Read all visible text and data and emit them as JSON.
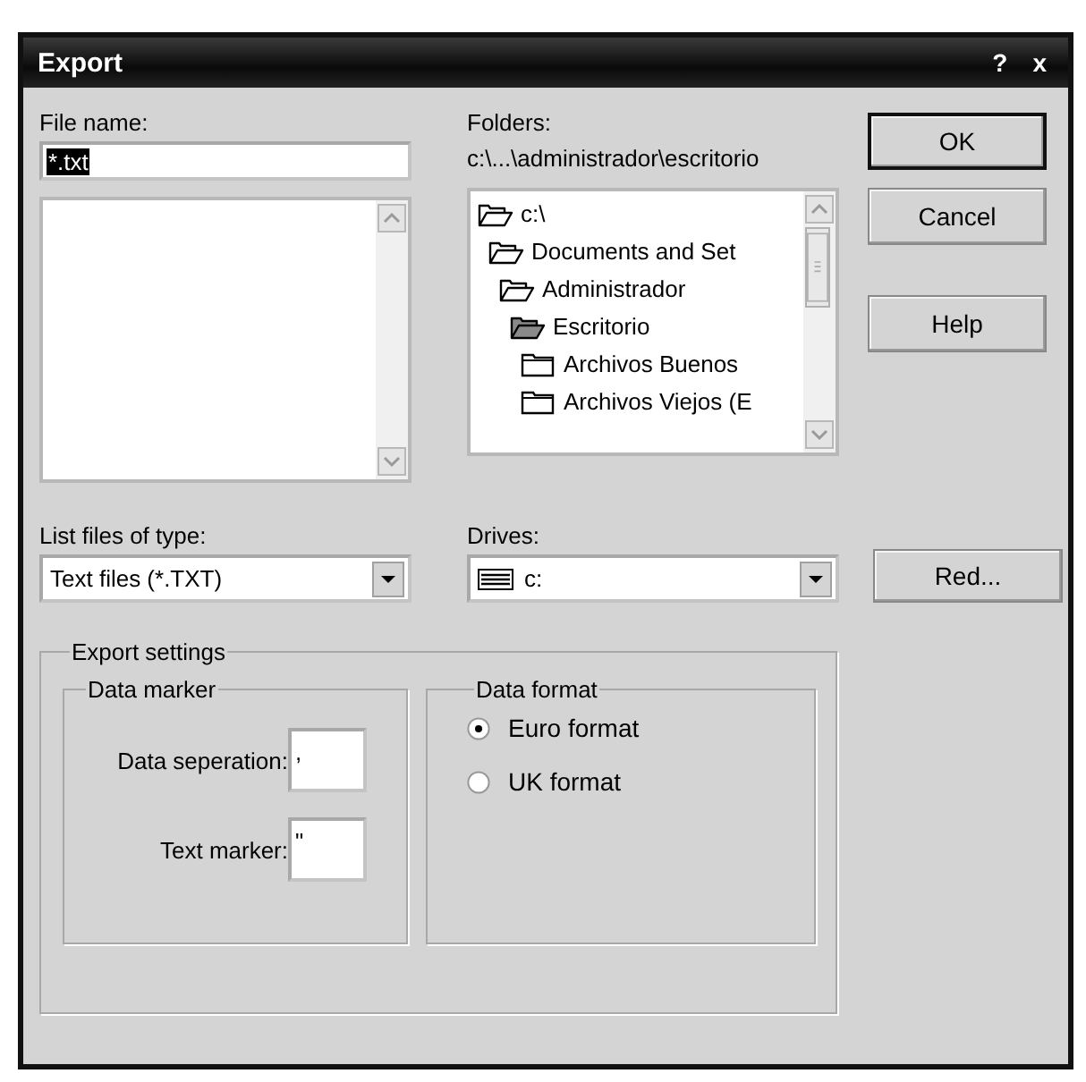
{
  "window": {
    "title": "Export",
    "title_buttons": [
      "?",
      "x"
    ]
  },
  "file_name": {
    "label": "File name:",
    "value": "*.txt",
    "selected": true
  },
  "folders": {
    "label": "Folders:",
    "path": "c:\\...\\administrador\\escritorio",
    "tree": [
      {
        "label": "c:\\",
        "kind": "open",
        "children": [
          {
            "label": "Documents and Set",
            "kind": "open",
            "children": [
              {
                "label": "Administrador",
                "kind": "open",
                "children": [
                  {
                    "label": "Escritorio",
                    "kind": "current",
                    "children": [
                      {
                        "label": "Archivos Buenos",
                        "kind": "closed"
                      },
                      {
                        "label": "Archivos Viejos (E",
                        "kind": "closed"
                      }
                    ]
                  }
                ]
              }
            ]
          }
        ]
      }
    ]
  },
  "file_type": {
    "label": "List files of type:",
    "value": "Text files (*.TXT)"
  },
  "drives": {
    "label": "Drives:",
    "value": "c:"
  },
  "buttons": [
    {
      "label": "OK",
      "default": true
    },
    {
      "label": "Cancel",
      "default": false
    },
    {
      "label": "Help",
      "default": false
    }
  ],
  "network_button": {
    "label": "Red..."
  },
  "export_settings": {
    "title": "Export settings",
    "data_marker": {
      "title": "Data marker",
      "fields": [
        {
          "label": "Data seperation:",
          "value": ","
        },
        {
          "label": "Text marker:",
          "value": "\""
        }
      ]
    },
    "data_format": {
      "title": "Data format",
      "options": [
        {
          "label": "Euro format",
          "selected": true
        },
        {
          "label": "UK format",
          "selected": false
        }
      ]
    }
  }
}
